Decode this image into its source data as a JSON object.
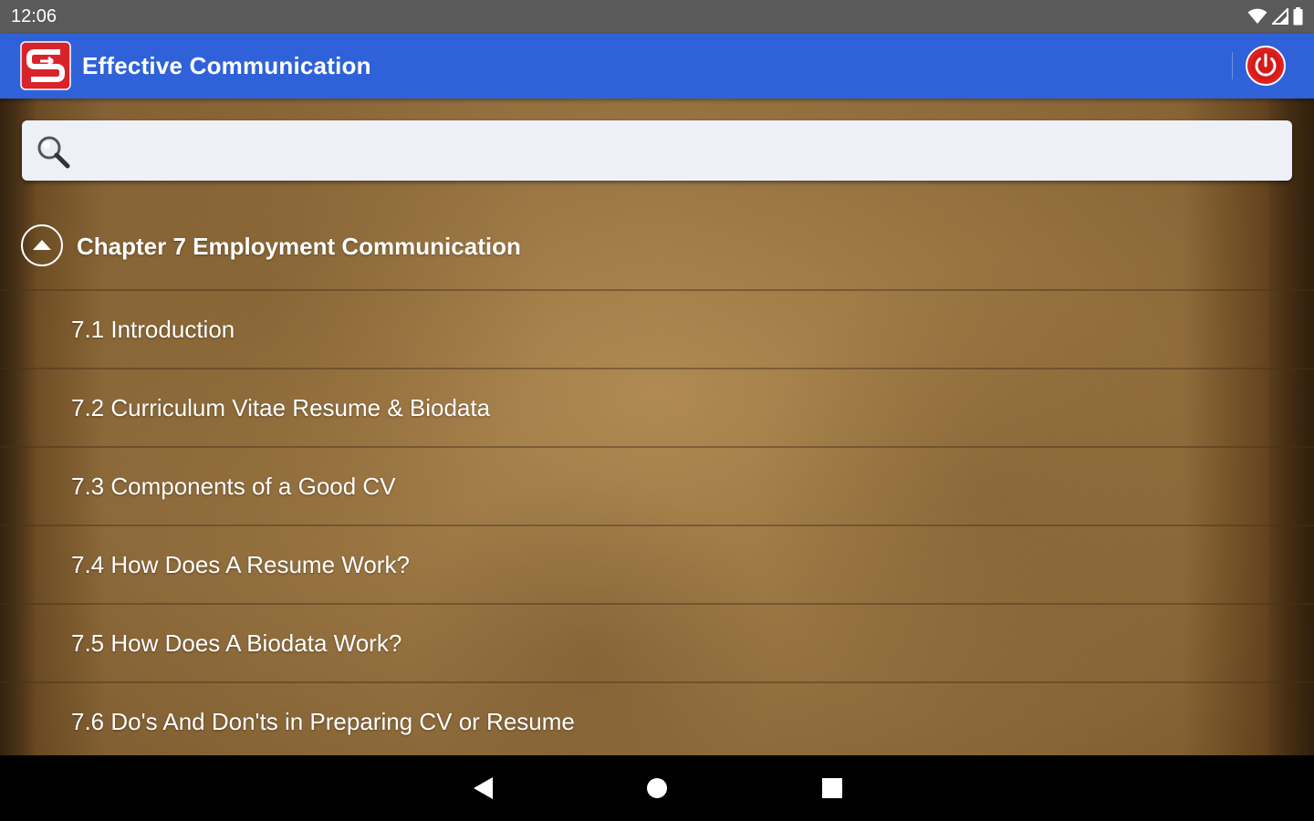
{
  "status_bar": {
    "time": "12:06",
    "icons": [
      "wifi-icon",
      "cell-signal-icon",
      "battery-icon"
    ]
  },
  "app_bar": {
    "title": "Effective Communication",
    "logo_icon": "app-logo-icon",
    "power_icon": "power-icon",
    "accent_color": "#2f62d9",
    "power_color": "#e02020"
  },
  "search": {
    "placeholder": "",
    "value": "",
    "icon": "search-icon"
  },
  "chapter": {
    "title": "Chapter 7 Employment Communication",
    "toggle_icon": "chevron-up-icon",
    "items": [
      {
        "label": "7.1 Introduction"
      },
      {
        "label": "7.2 Curriculum Vitae Resume & Biodata"
      },
      {
        "label": "7.3 Components of a Good CV"
      },
      {
        "label": "7.4 How Does A Resume Work?"
      },
      {
        "label": "7.5 How Does A Biodata Work?"
      },
      {
        "label": "7.6 Do's And Don'ts in Preparing CV or Resume"
      }
    ]
  },
  "nav_bar": {
    "back_icon": "back-icon",
    "home_icon": "home-icon",
    "recents_icon": "recents-icon"
  }
}
